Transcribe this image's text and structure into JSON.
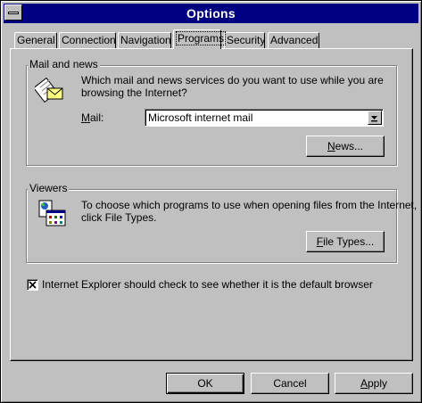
{
  "window": {
    "title": "Options"
  },
  "tabs": [
    "General",
    "Connection",
    "Navigation",
    "Programs",
    "Security",
    "Advanced"
  ],
  "active_tab": "Programs",
  "mail_news": {
    "group_label": "Mail and news",
    "description_line1": "Which mail and news services do you want to use while you are",
    "description_line2": "browsing the Internet?",
    "mail_label": "Mail:",
    "mail_value": "Microsoft internet mail",
    "news_button": "News..."
  },
  "viewers": {
    "group_label": "Viewers",
    "description_line1": "To choose which programs to use when opening files from the Internet,",
    "description_line2": "click File Types.",
    "file_types_button": "File Types..."
  },
  "default_browser_check": {
    "label": "Internet Explorer should check to see whether it is the default browser",
    "checked": true
  },
  "buttons": {
    "ok": "OK",
    "cancel": "Cancel",
    "apply": "Apply"
  }
}
